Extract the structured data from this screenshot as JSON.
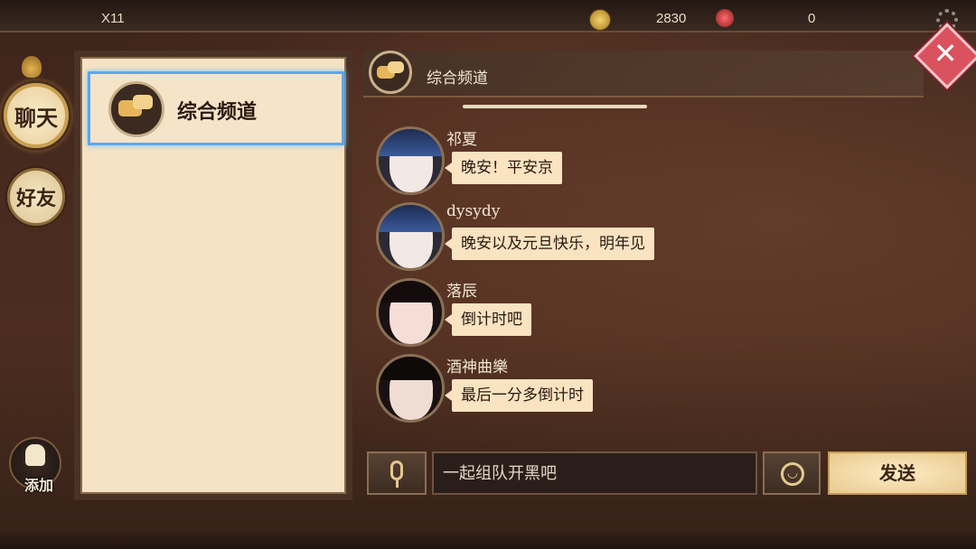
{
  "topbar": {
    "level": "X11",
    "coins": "2830",
    "jade": "0"
  },
  "nav": {
    "chat_label": "聊天",
    "friends_label": "好友",
    "add_label": "添加"
  },
  "channel_list": {
    "items": [
      {
        "label": "综合频道",
        "selected": true
      }
    ]
  },
  "chat": {
    "channel_title": "综合频道",
    "messages": [
      {
        "name": "祁夏",
        "text": "晚安！平安京",
        "avatar": "white-hair-hero"
      },
      {
        "name": "dysydy",
        "text": "晚安以及元旦快乐，明年见",
        "avatar": "white-hair-hero"
      },
      {
        "name": "落辰",
        "text": "倒计时吧",
        "avatar": "red-eyed-girl"
      },
      {
        "name": "酒神曲樂",
        "text": "最后一分多倒计时",
        "avatar": "dark-hair-demon"
      }
    ]
  },
  "input": {
    "placeholder": "一起组队开黑吧",
    "send_label": "发送"
  },
  "icons": {
    "voice": "microphone-icon",
    "emoji": "smiley-icon",
    "close": "close-icon",
    "settings": "gear-icon",
    "channel": "chat-bubbles-icon"
  },
  "colors": {
    "panel_bg": "#f6e2c4",
    "selected_border": "#5aa8f0",
    "bubble_bg": "#f9e3c1",
    "close_red": "#d9525e"
  }
}
